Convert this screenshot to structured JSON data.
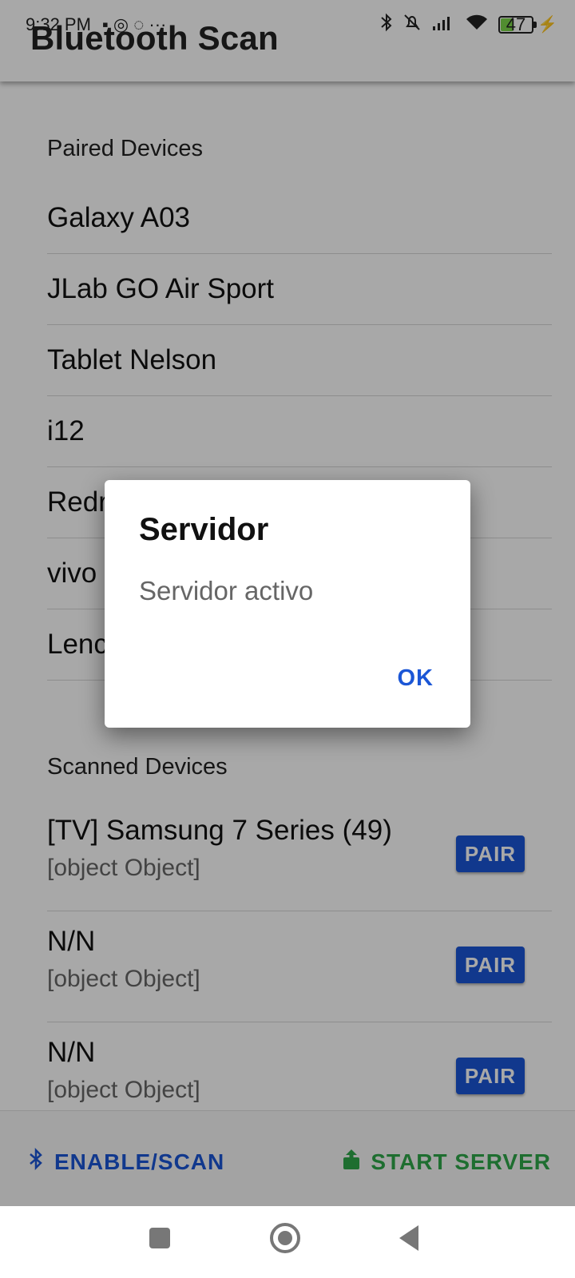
{
  "status_bar": {
    "time": "9:32 PM",
    "left_icons": "▪ ◎ ◌ ···",
    "battery": "47"
  },
  "app_bar": {
    "title": "Bluetooth Scan"
  },
  "paired": {
    "title": "Paired Devices",
    "items": [
      "Galaxy A03",
      "JLab GO Air Sport",
      "Tablet Nelson",
      "i12",
      "Redr",
      "vivo",
      "Lenc"
    ]
  },
  "scanned": {
    "title": "Scanned Devices",
    "pair_label": "PAIR",
    "items": [
      {
        "name": "[TV] Samsung 7 Series (49)",
        "detail": "[object Object]"
      },
      {
        "name": "N/N",
        "detail": "[object Object]"
      },
      {
        "name": "N/N",
        "detail": "[object Object]"
      }
    ]
  },
  "bottom_bar": {
    "enable_label": "ENABLE/SCAN",
    "server_label": "START SERVER"
  },
  "dialog": {
    "title": "Servidor",
    "message": "Servidor activo",
    "ok_label": "OK"
  },
  "colors": {
    "accent_blue": "#1b56d6",
    "server_green": "#2ea84a"
  }
}
